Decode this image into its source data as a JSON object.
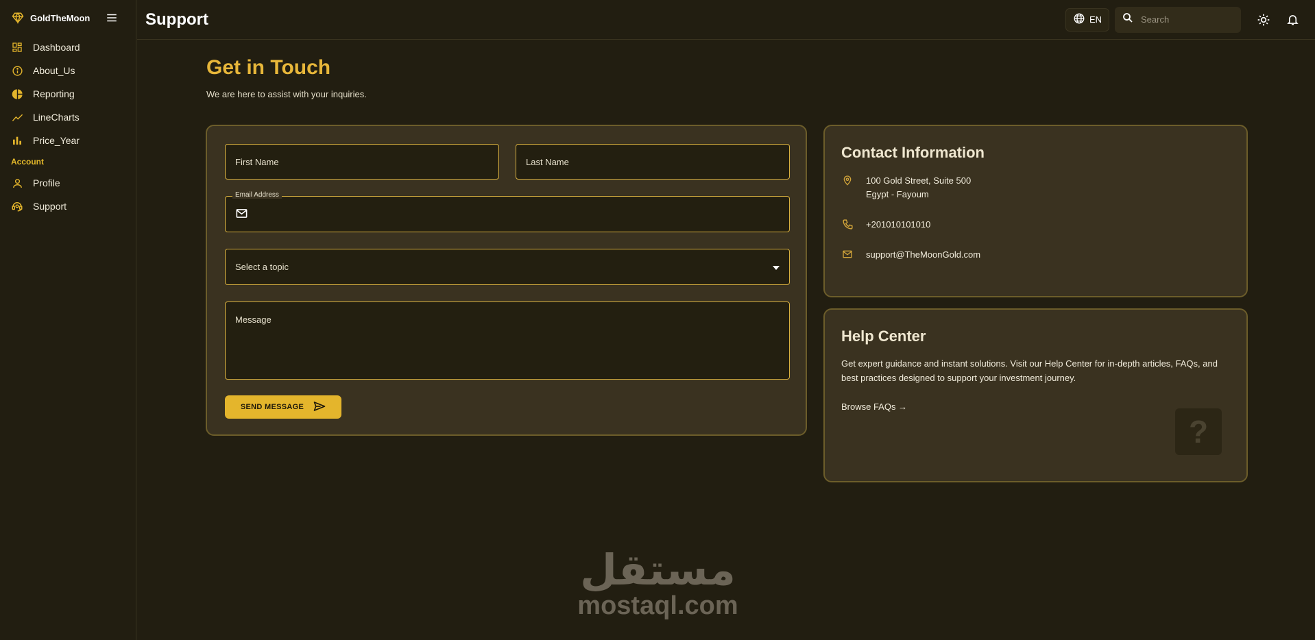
{
  "brand": {
    "name": "GoldTheMoon"
  },
  "sidebar": {
    "items": [
      {
        "label": "Dashboard",
        "icon": "dashboard-icon"
      },
      {
        "label": "About_Us",
        "icon": "info-icon"
      },
      {
        "label": "Reporting",
        "icon": "pie-chart-icon"
      },
      {
        "label": "LineCharts",
        "icon": "line-chart-icon"
      },
      {
        "label": "Price_Year",
        "icon": "bar-chart-icon"
      }
    ],
    "section_label": "Account",
    "account_items": [
      {
        "label": "Profile",
        "icon": "person-icon"
      },
      {
        "label": "Support",
        "icon": "support-agent-icon"
      }
    ]
  },
  "header": {
    "title": "Support",
    "language": "EN",
    "search_placeholder": "Search"
  },
  "main": {
    "heading": "Get in Touch",
    "subheading": "We are here to assist with your inquiries.",
    "form": {
      "first_name_placeholder": "First Name",
      "last_name_placeholder": "Last Name",
      "email_label": "Email Address",
      "topic_placeholder": "Select a topic",
      "message_placeholder": "Message",
      "send_label": "SEND MESSAGE"
    },
    "contact": {
      "title": "Contact Information",
      "address_line1": "100 Gold Street, Suite 500",
      "address_line2": "Egypt - Fayoum",
      "phone": "+201010101010",
      "email": "support@TheMoonGold.com"
    },
    "help": {
      "title": "Help Center",
      "text": "Get expert guidance and instant solutions. Visit our Help Center for in-depth articles, FAQs, and best practices designed to support your investment journey.",
      "link": "Browse FAQs →",
      "badge": "?"
    }
  },
  "watermark": {
    "arabic": "مستقل",
    "latin": "mostaql.com"
  },
  "colors": {
    "accent": "#e4b52c",
    "background": "#221e11",
    "card": "#3a3220",
    "border": "#6c5d2a"
  }
}
